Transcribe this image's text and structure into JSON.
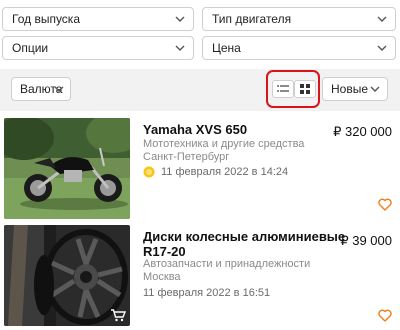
{
  "filters": {
    "year": "Год выпуска",
    "engine": "Тип двигателя",
    "options": "Опции",
    "price": "Цена"
  },
  "toolbar": {
    "currency": "Валюта",
    "sort": "Новые"
  },
  "listings": [
    {
      "title": "Yamaha XVS 650",
      "price": "₽ 320 000",
      "category": "Мототехника и другие средства",
      "city": "Санкт-Петербург",
      "date": "11 февраля 2022 в 14:24"
    },
    {
      "title_line1": "Диски колесные алюминиевые",
      "title_line2": "R17-20",
      "price": "₽ 39 000",
      "category": "Автозапчасти и принадлежности",
      "city": "Москва",
      "date": "11 февраля 2022 в 16:51"
    }
  ],
  "colors": {
    "accent_orange": "#f07d1a",
    "highlight_red": "#d8141c",
    "coin_yellow": "#f5c518"
  }
}
